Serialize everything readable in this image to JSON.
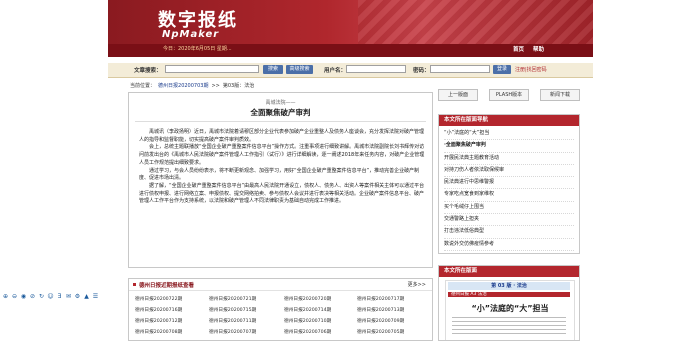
{
  "header": {
    "brand_cn": "数字报纸",
    "brand_en": "NpMaker",
    "date_text": "今日：2020年6月05日 星期...",
    "home": "首页",
    "help": "帮助"
  },
  "search": {
    "article_label": "文章搜索：",
    "search_btn": "搜索",
    "advanced_btn": "高级搜索",
    "user_label": "用户名：",
    "password_label": "密码：",
    "login_btn": "登录",
    "register_link": "注册|找回密码"
  },
  "breadcrumb": {
    "prefix": "当前位置：",
    "paper": "德州日报20200703期",
    "sep": ">>",
    "page": "第03版：法治"
  },
  "article": {
    "subtitle": "禹城法院——",
    "title": "全面聚焦破产审判",
    "paragraphs": [
      "禹城讯（李政扬明）近日，禹城市法院着请穆区部分企业代表参加破产企业重整人及债务人座谈会，充分发挥法院对破产管理人的指导和监督职能，切实提高破产案件审判质效。",
      "会上，总统主题联播放“全国企业破产重整案件信息平台”操作方式。注重事项进行细致讲解。禹城市法院副院长刘书辉传对访问前发出台的《禹城市人民法院破产案件管理人工作指引（试行）》进行详细解读，逐一阐述2018年来任务内容，对破产企业管理人员工作规范提出细致要求。",
      "通过学习，与会人员纷纷表示，将不断更新观念、加强学习，用好“全国企业破产重整案件信息平台”，推动完善企业破产制度、促进市场出清。",
      "据了解，“全国企业破产重整案件信息平台”由最高人民法院开通设立，债权人、债务人、出资人等案件相关主体可以通过平台进行债权申报、进行网络立案、申报债权、提交网络拍卖、参与债权人会议并进行表决等相关活动。企业破产案件信息平台、破产管理人工作平台作为支持系统，以法院和破产管理人不同法律职责为基础自动完成工作推进。"
    ]
  },
  "toolbar": {
    "buttons": [
      "上一版面",
      "PLASH版本",
      "新闻下载"
    ]
  },
  "nav": {
    "title": "本文所在版面导航",
    "items": [
      "“小”法庭的“大”担当",
      "·全面聚焦破产审判",
      "开展民法典主题教育活动",
      "对持刀伤人者依法取保候审",
      "民法典进行中思维警报",
      "专家吃点宽食到家维权",
      "买个毛绒仔上围当",
      "交通警路上担夹",
      "打击违法低俗典型",
      "数说外交仿佛疫情参考"
    ],
    "active_index": 1
  },
  "pdf": {
    "title": "本文所在版面",
    "page_label": "第 03 版 · 法治",
    "mast": "德州日报 A3 法治",
    "headline": "“小”法庭的“大”担当"
  },
  "issues": {
    "title": "德州日报近期报纸查看",
    "more": "更多>>",
    "rows": [
      [
        "德州日报20200722期",
        "德州日报20200721期",
        "德州日报20200720期",
        "德州日报20200717期"
      ],
      [
        "德州日报20200716期",
        "德州日报20200715期",
        "德州日报20200714期",
        "德州日报20200713期"
      ],
      [
        "德州日报20200712期",
        "德州日报20200711期",
        "德州日报20200710期",
        "德州日报20200709期"
      ],
      [
        "德州日报20200708期",
        "德州日报20200707期",
        "德州日报20200706期",
        "德州日报20200705期"
      ]
    ]
  },
  "left_tools": [
    "⊕",
    "⊖",
    "◉",
    "⊘",
    "↻",
    "☺",
    "Ǝ",
    "✉",
    "⚙",
    "▲",
    "☰"
  ],
  "colors": {
    "brand_red": "#b3262d",
    "dark_red": "#7a0f16",
    "link_blue": "#1b3c8c"
  }
}
